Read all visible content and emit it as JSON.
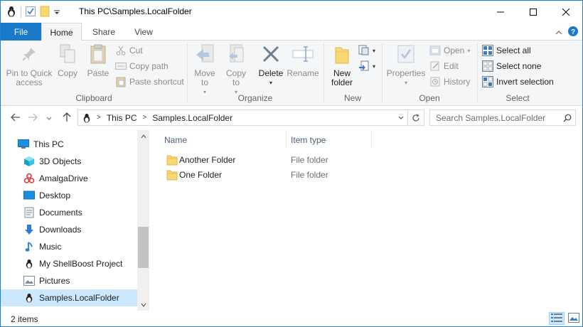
{
  "window": {
    "title": "This PC\\Samples.LocalFolder"
  },
  "ribbon_tabs": {
    "file": "File",
    "home": "Home",
    "share": "Share",
    "view": "View"
  },
  "ribbon": {
    "clipboard": {
      "label": "Clipboard",
      "pin": "Pin to Quick access",
      "copy": "Copy",
      "paste": "Paste",
      "cut": "Cut",
      "copy_path": "Copy path",
      "paste_shortcut": "Paste shortcut"
    },
    "organize": {
      "label": "Organize",
      "move_to": "Move to",
      "copy_to": "Copy to",
      "delete": "Delete",
      "rename": "Rename"
    },
    "new": {
      "label": "New",
      "new_folder": "New folder"
    },
    "open": {
      "label": "Open",
      "properties": "Properties",
      "open": "Open",
      "edit": "Edit",
      "history": "History"
    },
    "select": {
      "label": "Select",
      "select_all": "Select all",
      "select_none": "Select none",
      "invert_selection": "Invert selection"
    }
  },
  "address": {
    "crumbs": [
      "This PC",
      "Samples.LocalFolder"
    ],
    "search_placeholder": "Search Samples.LocalFolder"
  },
  "nav_pane": {
    "items": [
      {
        "label": "This PC",
        "icon": "pc-icon"
      },
      {
        "label": "3D Objects",
        "icon": "cube-icon"
      },
      {
        "label": "AmalgaDrive",
        "icon": "amalga-icon"
      },
      {
        "label": "Desktop",
        "icon": "desktop-icon"
      },
      {
        "label": "Documents",
        "icon": "documents-icon"
      },
      {
        "label": "Downloads",
        "icon": "download-icon"
      },
      {
        "label": "Music",
        "icon": "music-icon"
      },
      {
        "label": "My ShellBoost Project",
        "icon": "penguin-icon"
      },
      {
        "label": "Pictures",
        "icon": "pictures-icon"
      },
      {
        "label": "Samples.LocalFolder",
        "icon": "penguin-icon"
      }
    ],
    "selected": "Samples.LocalFolder"
  },
  "file_list": {
    "columns": [
      "Name",
      "Item type"
    ],
    "rows": [
      {
        "name": "Another Folder",
        "type": "File folder"
      },
      {
        "name": "One Folder",
        "type": "File folder"
      }
    ]
  },
  "status": {
    "item_count": "2 items"
  },
  "colors": {
    "accent": "#1979ca",
    "selection": "#cce8ff",
    "folder": "#f8d775"
  }
}
